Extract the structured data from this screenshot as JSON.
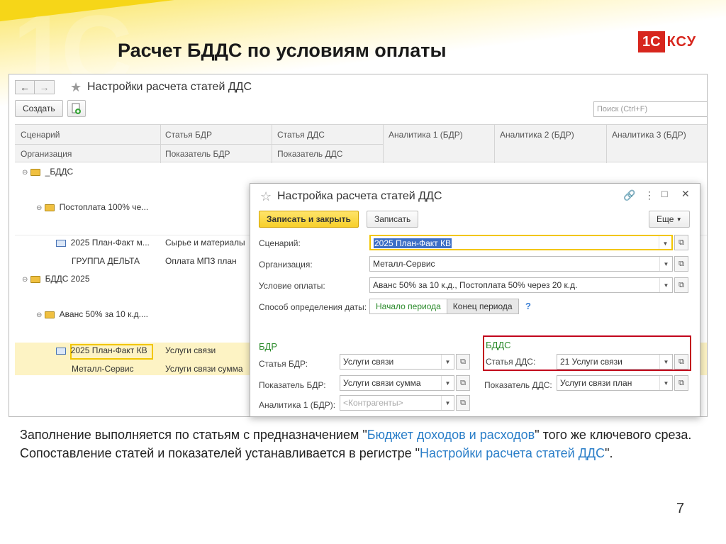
{
  "slide": {
    "title": "Расчет БДДС по условиям оплаты",
    "brand_1c": "1С",
    "brand_ksu": "КСУ",
    "page_number": "7"
  },
  "window": {
    "title": "Настройки расчета статей ДДС",
    "back_icon": "arrow-left-icon",
    "forward_icon": "arrow-right-icon",
    "create_label": "Создать",
    "search_placeholder": "Поиск (Ctrl+F)",
    "columns": {
      "c1_top": "Сценарий",
      "c1_bottom": "Организация",
      "c2_top": "Статья БДР",
      "c2_bottom": "Показатель БДР",
      "c3_top": "Статья ДДС",
      "c3_bottom": "Показатель ДДС",
      "c4": "Аналитика 1 (БДР)",
      "c5": "Аналитика 2 (БДР)",
      "c6": "Аналитика 3 (БДР)"
    },
    "rows": [
      {
        "level": 0,
        "label": "_БДДС"
      },
      {
        "level": 1,
        "label": "Постоплата 100% че..."
      },
      {
        "level": 2,
        "col1": "2025 План-Факт м...",
        "col2": "Сырье и материалы",
        "col1b": "ГРУППА ДЕЛЬТА",
        "col2b": "Оплата МПЗ план"
      },
      {
        "level": 0,
        "label": "БДДС 2025"
      },
      {
        "level": 1,
        "label": "Аванс 50% за 10 к.д...."
      },
      {
        "level": 2,
        "col1": "2025 План-Факт КВ",
        "col2": "Услуги связи",
        "col1b": "Металл-Сервис",
        "col2b": "Услуги связи сумма"
      }
    ]
  },
  "dialog": {
    "title": "Настройка расчета статей ДДС",
    "save_close_label": "Записать и закрыть",
    "save_label": "Записать",
    "more_label": "Еще",
    "scenario_label": "Сценарий:",
    "scenario_value": "2025 План-Факт КВ",
    "org_label": "Организация:",
    "org_value": "Металл-Сервис",
    "payment_label": "Условие оплаты:",
    "payment_value": "Аванс 50% за 10 к.д., Постоплата 50% через 20 к.д.",
    "date_method_label": "Способ определения даты:",
    "date_start": "Начало периода",
    "date_end": "Конец периода",
    "help": "?",
    "bdr_title": "БДР",
    "bdr_article_label": "Статья БДР:",
    "bdr_article_value": "Услуги связи",
    "bdr_indicator_label": "Показатель БДР:",
    "bdr_indicator_value": "Услуги связи сумма",
    "bdr_analytics_label": "Аналитика 1 (БДР):",
    "bdr_analytics_value": "<Контрагенты>",
    "bdds_title": "БДДС",
    "dds_article_label": "Статья ДДС:",
    "dds_article_value": "21 Услуги связи",
    "dds_indicator_label": "Показатель ДДС:",
    "dds_indicator_value": "Услуги связи план"
  },
  "caption": {
    "p1": "Заполнение выполняется по статьям с предназначением \"",
    "link1": "Бюджет доходов и расходов",
    "p2": "\" того же ключевого среза. Сопоставление статей и показателей устанавливается в регистре \"",
    "link2": "Настройки расчета статей ДДС",
    "p3": "\"."
  },
  "colors": {
    "accent_yellow": "#f6d618",
    "brand_red": "#d7261d",
    "link_blue": "#2a7ec8",
    "section_green": "#2a8a2a",
    "highlight_red": "#c2001c"
  }
}
